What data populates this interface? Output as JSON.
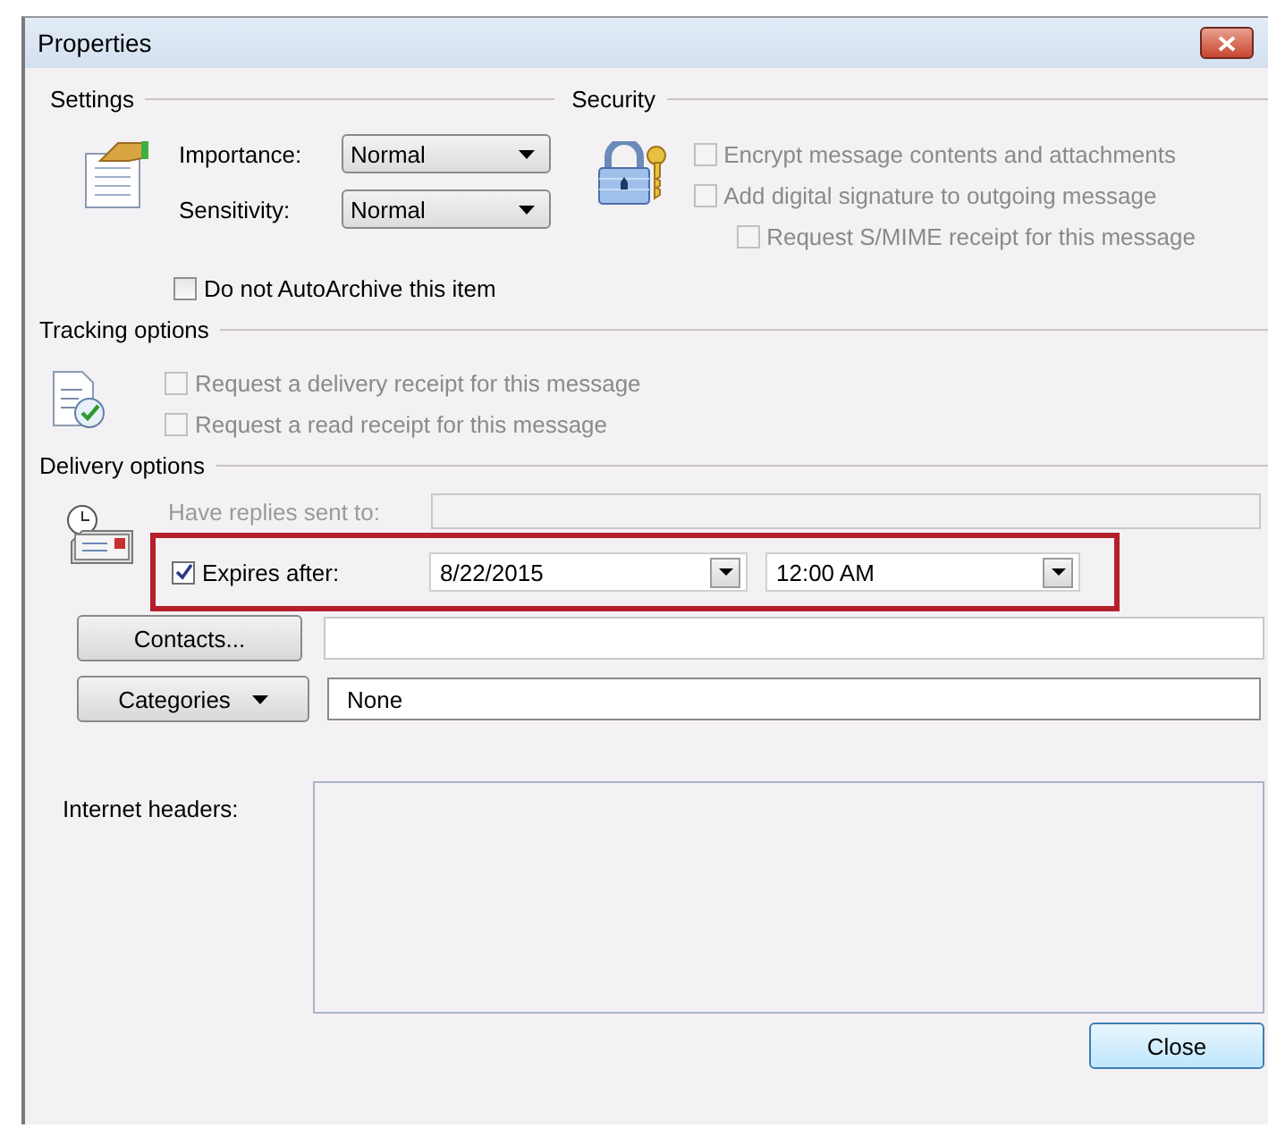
{
  "window": {
    "title": "Properties"
  },
  "settings": {
    "title": "Settings",
    "fields": [
      {
        "label": "Importance:",
        "value": "Normal"
      },
      {
        "label": "Sensitivity:",
        "value": "Normal"
      }
    ],
    "auto_archive": {
      "label": "Do not AutoArchive this item",
      "checked": false
    }
  },
  "security": {
    "title": "Security",
    "options": [
      {
        "label": "Encrypt message contents and attachments",
        "checked": false,
        "disabled": true
      },
      {
        "label": "Add digital signature to outgoing message",
        "checked": false,
        "disabled": true,
        "children": [
          {
            "label": "Request S/MIME receipt for this message",
            "checked": false,
            "disabled": true
          }
        ]
      }
    ]
  },
  "tracking": {
    "title": "Tracking options",
    "options": [
      {
        "label": "Request a delivery receipt for this message",
        "checked": false,
        "disabled": true
      },
      {
        "label": "Request a read receipt for this message",
        "checked": false,
        "disabled": true
      }
    ]
  },
  "delivery": {
    "title": "Delivery options",
    "replies": {
      "label": "Have replies sent to:",
      "disabled": true
    },
    "expires": {
      "label": "Expires after:",
      "checked": true,
      "date": "8/22/2015",
      "time": "12:00 AM",
      "highlighted": true
    }
  },
  "contacts": {
    "button": "Contacts..."
  },
  "categories": {
    "button": "Categories",
    "value": "None"
  },
  "internet_headers": {
    "label": "Internet headers:"
  },
  "buttons": [
    {
      "label": "Close"
    }
  ]
}
